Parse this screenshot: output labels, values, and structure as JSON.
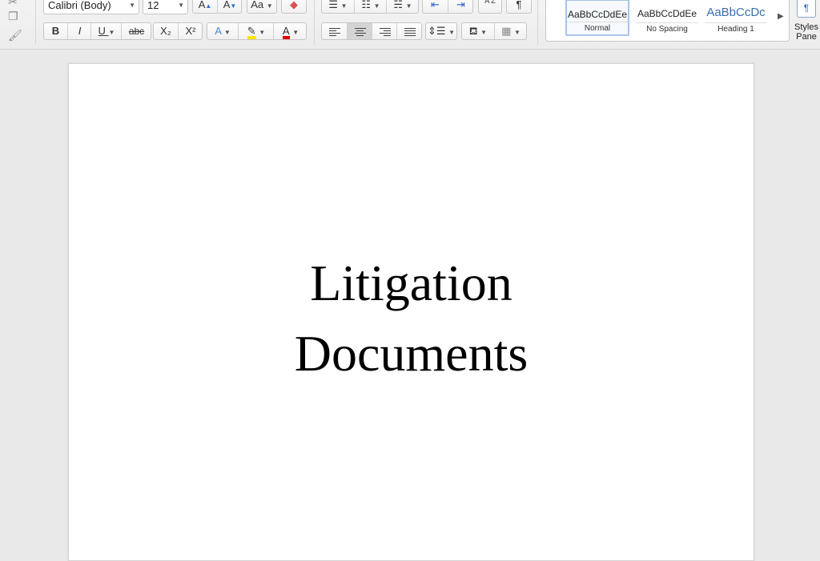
{
  "toolbar": {
    "font_name": "Calibri (Body)",
    "font_size": "12",
    "grow_font_label": "A",
    "shrink_font_label": "A",
    "change_case_label": "Aa",
    "bold_label": "B",
    "italic_label": "I",
    "underline_label": "U",
    "strikethrough_label": "abc",
    "subscript_label": "X₂",
    "superscript_label": "X²",
    "text_effects_label": "A",
    "font_color_label": "A",
    "sort_label": "A Z",
    "pilcrow_label": "¶",
    "highlight_color": "#ffe600",
    "font_color": "#e00000"
  },
  "styles_gallery": {
    "items": [
      {
        "preview": "AaBbCcDdEe",
        "name": "Normal"
      },
      {
        "preview": "AaBbCcDdEe",
        "name": "No Spacing"
      },
      {
        "preview": "AaBbCcDc",
        "name": "Heading 1"
      }
    ]
  },
  "styles_pane": {
    "label_line1": "Styles",
    "label_line2": "Pane"
  },
  "document": {
    "title_line1": "Litigation",
    "title_line2": "Documents"
  }
}
